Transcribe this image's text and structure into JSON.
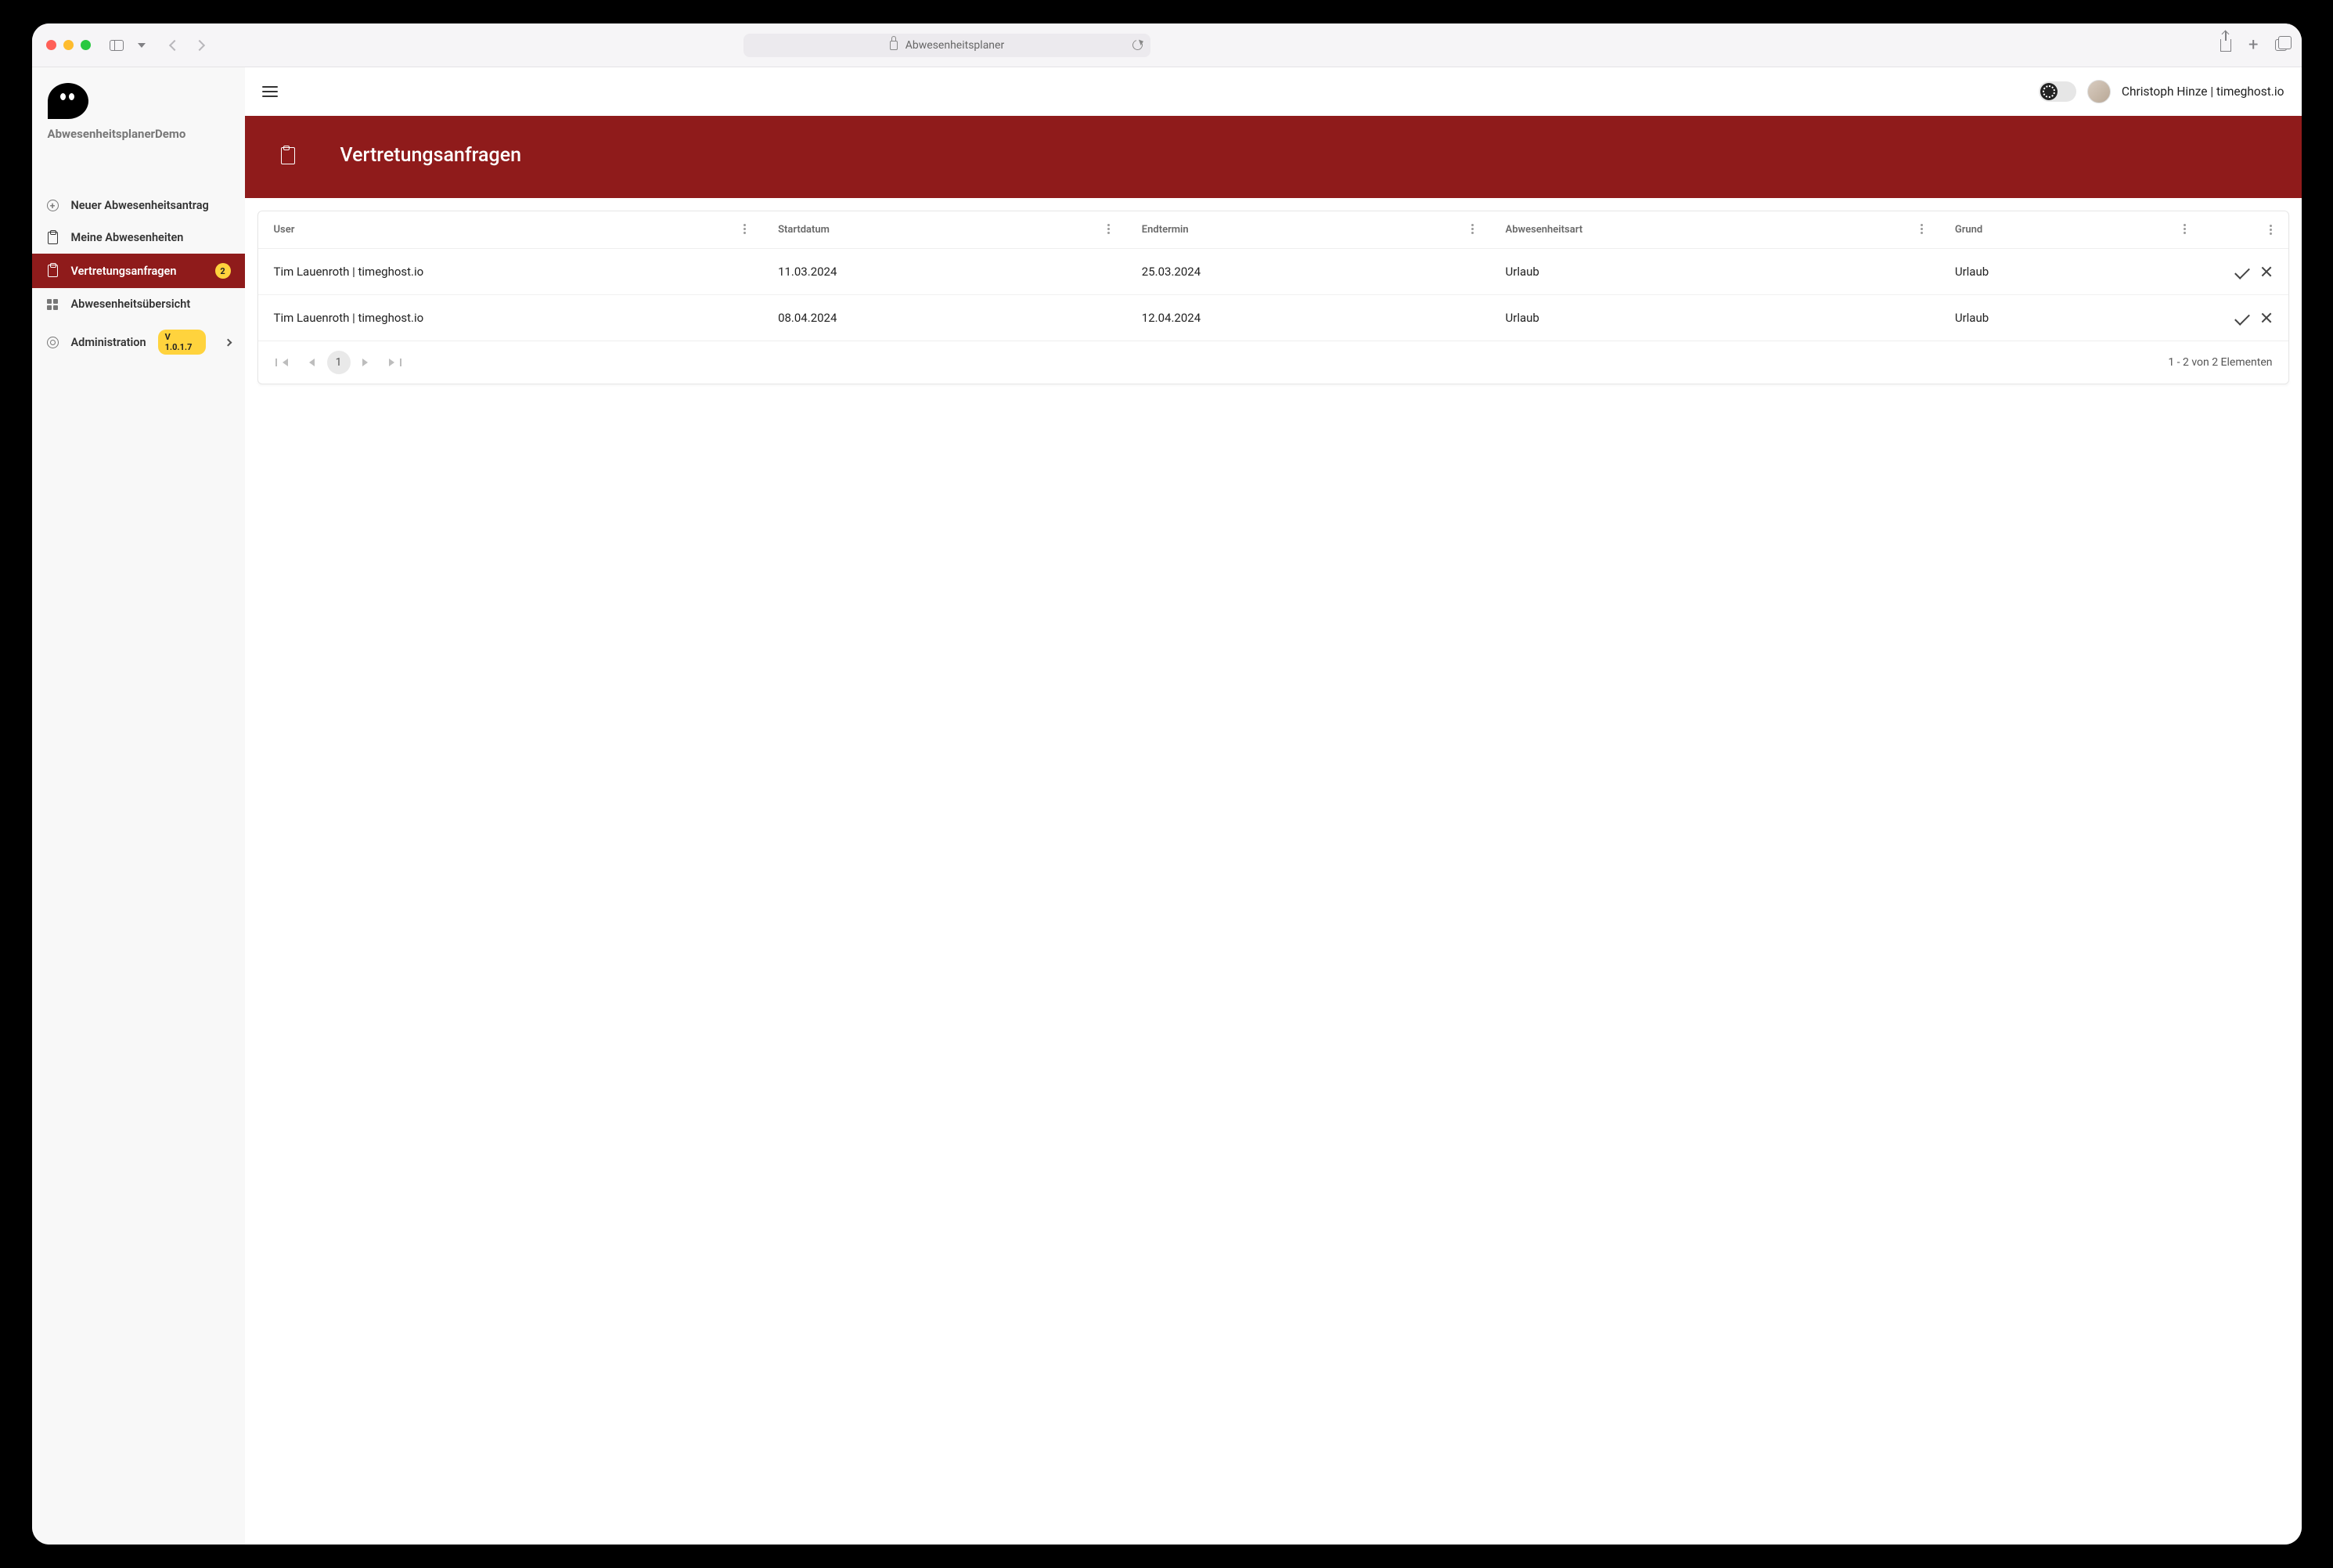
{
  "browser": {
    "page_title": "Abwesenheitsplaner"
  },
  "sidebar": {
    "app_name": "AbwesenheitsplanerDemo",
    "items": [
      {
        "label": "Neuer Abwesenheitsantrag"
      },
      {
        "label": "Meine Abwesenheiten"
      },
      {
        "label": "Vertretungsanfragen",
        "badge": "2",
        "active": true
      },
      {
        "label": "Abwesenheitsübersicht"
      },
      {
        "label": "Administration",
        "version": "V 1.0.1.7"
      }
    ]
  },
  "topbar": {
    "user": "Christoph Hinze | timeghost.io"
  },
  "hero": {
    "title": "Vertretungsanfragen"
  },
  "table": {
    "columns": {
      "user": "User",
      "start": "Startdatum",
      "end": "Endtermin",
      "type": "Abwesenheitsart",
      "reason": "Grund"
    },
    "rows": [
      {
        "user": "Tim Lauenroth | timeghost.io",
        "start": "11.03.2024",
        "end": "25.03.2024",
        "type": "Urlaub",
        "reason": "Urlaub"
      },
      {
        "user": "Tim Lauenroth | timeghost.io",
        "start": "08.04.2024",
        "end": "12.04.2024",
        "type": "Urlaub",
        "reason": "Urlaub"
      }
    ],
    "pager": {
      "current": "1",
      "info": "1 - 2 von 2 Elementen"
    }
  }
}
